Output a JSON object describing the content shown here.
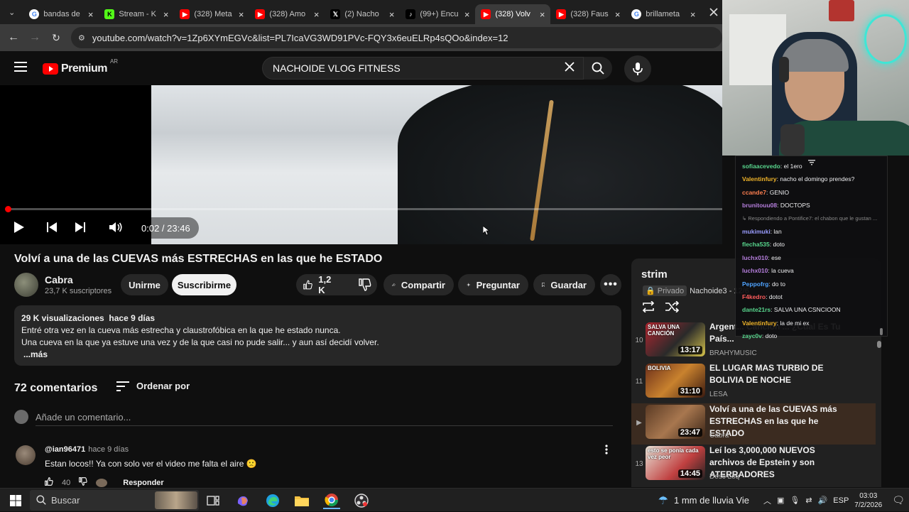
{
  "browser": {
    "tabs": [
      {
        "label": "bandas de",
        "icon": "google-icon",
        "color": "#4285f4",
        "active": false
      },
      {
        "label": "Stream - K",
        "icon": "kick-icon",
        "color": "#53fc18",
        "active": false
      },
      {
        "label": "(328) Meta",
        "icon": "youtube-icon",
        "color": "#ff0000",
        "active": false
      },
      {
        "label": "(328) Amo",
        "icon": "youtube-icon",
        "color": "#ff0000",
        "active": false
      },
      {
        "label": "(2) Nacho",
        "icon": "x-icon",
        "color": "#000000",
        "active": false
      },
      {
        "label": "(99+) Encu",
        "icon": "tiktok-icon",
        "color": "#000000",
        "active": false
      },
      {
        "label": "(328) Volv",
        "icon": "youtube-icon",
        "color": "#ff0000",
        "active": true
      },
      {
        "label": "(328) Faus",
        "icon": "youtube-icon",
        "color": "#ff0000",
        "active": false
      },
      {
        "label": "brillameta",
        "icon": "google-icon",
        "color": "#4285f4",
        "active": false
      }
    ],
    "url": "youtube.com/watch?v=1Zp6XYmEGVc&list=PL7IcaVG3WD91PVc-FQY3x6euELRp4sQOo&index=12"
  },
  "youtube": {
    "logo_text": "Premium",
    "region": "AR",
    "search_value": "NACHOIDE VLOG FITNESS",
    "player": {
      "time": "0:02 / 23:46",
      "progress": 0.0014
    },
    "video": {
      "title": "Volví a una de las CUEVAS más ESTRECHAS en las que he ESTADO",
      "channel": "Cabra",
      "subscribers": "23,7 K suscriptores",
      "join_label": "Unirme",
      "subscribe_label": "Suscribirme",
      "likes": "1,2 K",
      "share_label": "Compartir",
      "ask_label": "Preguntar",
      "save_label": "Guardar"
    },
    "description": {
      "stats": "29 K visualizaciones  hace 9 días",
      "line1": "Entré otra vez en la cueva más estrecha y claustrofóbica en la que he estado nunca.",
      "line2": "Una cueva en la que ya estuve una vez y de la que casi no pude salir... y aun así decidí volver.",
      "more": "...más"
    },
    "comments": {
      "count": "72 comentarios",
      "sort_label": "Ordenar por",
      "add_placeholder": "Añade un comentario...",
      "items": [
        {
          "user": "@ian96471",
          "time": "hace 9 días",
          "text": "Estan locos!! Ya con solo ver el video me falta el aire 🙁",
          "likes": "40",
          "reply_label": "Responder"
        }
      ]
    },
    "playlist": {
      "name": "strim",
      "privacy": "Privado",
      "owner": "Nachoide3 - 12/6",
      "items": [
        {
          "index": "10",
          "title": "Argent... Canción ... ¿Cual Es Tu País...",
          "channel": "BRAHYMUSIC",
          "duration": "13:17",
          "thumb_text": "SALVA UNA CANCIÓN",
          "active": false
        },
        {
          "index": "11",
          "title": "EL LUGAR MAS TURBIO DE BOLIVIA DE NOCHE",
          "channel": "LESA",
          "duration": "31:10",
          "thumb_text": "BOLIVIA",
          "active": false
        },
        {
          "index": "▶",
          "title": "Volví a una de las CUEVAS más ESTRECHAS en las que he ESTADO",
          "channel": "Cabra",
          "duration": "23:47",
          "thumb_text": "",
          "active": true
        },
        {
          "index": "13",
          "title": "Leí los 3,000,000 NUEVOS archivos de Epstein y son ATERRADORES",
          "channel": "Desc Loq",
          "duration": "14:45",
          "thumb_text": "esto se ponía cada vez peor",
          "active": false
        }
      ]
    }
  },
  "chat": {
    "messages": [
      {
        "user": "sofiaacevedo",
        "color": "#58d68d",
        "text": "el 1ero"
      },
      {
        "user": "Valentinfury",
        "color": "#f0b429",
        "text": "nacho el domingo prendes?"
      },
      {
        "user": "ccande7",
        "color": "#ff7f50",
        "text": "GENIO"
      },
      {
        "user": "brunitouu08",
        "color": "#b57edc",
        "text": "DOCTOPS"
      },
      {
        "user": "",
        "color": "#888888",
        "text": "↳ Respondiendo a Pontifice7: el chabon que le gustan ..."
      },
      {
        "user": "mukimuki",
        "color": "#9a9cff",
        "text": "lan"
      },
      {
        "user": "flecha535",
        "color": "#58d68d",
        "text": "doto"
      },
      {
        "user": "luchx010",
        "color": "#b57edc",
        "text": "ese"
      },
      {
        "user": "luchx010",
        "color": "#b57edc",
        "text": "la cueva"
      },
      {
        "user": "Peppofrg",
        "color": "#4fa3ff",
        "text": "do to"
      },
      {
        "user": "F4kedro",
        "color": "#ff5c5c",
        "text": "dotot"
      },
      {
        "user": "dante21rs",
        "color": "#58d68d",
        "text": "SALVA UNA CSNCIOON"
      },
      {
        "user": "Valentinfury",
        "color": "#f0b429",
        "text": "la de mi ex"
      },
      {
        "user": "zayc0v",
        "color": "#58d68d",
        "text": "doto"
      }
    ]
  },
  "taskbar": {
    "search_placeholder": "Buscar",
    "weather": "1 mm de lluvia Vie",
    "lang": "ESP",
    "time": "03:03",
    "date": "7/2/2026"
  }
}
